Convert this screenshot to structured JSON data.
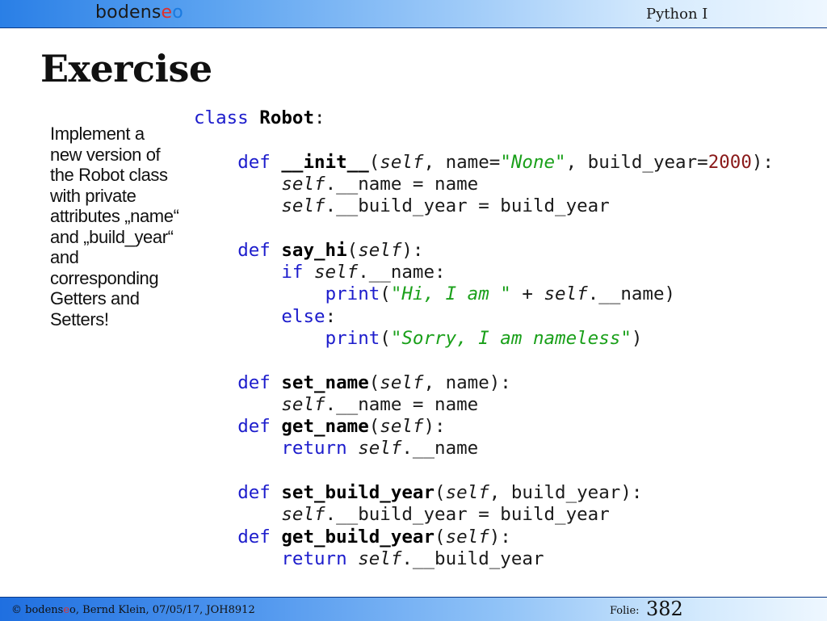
{
  "header": {
    "logo_main": "bodens",
    "logo_e": "e",
    "logo_o": "o",
    "course": "Python I"
  },
  "title": "Exercise",
  "side_text": "Implement a new version of the Robot class with private attributes „name“ and „build_year“ and corresponding Getters and Setters!",
  "code_lines": [
    "class Robot:",
    "",
    "    def __init__(self, name=\"None\", build_year=2000):",
    "        self.__name = name",
    "        self.__build_year = build_year",
    "",
    "    def say_hi(self):",
    "        if self.__name:",
    "            print(\"Hi, I am \" + self.__name)",
    "        else:",
    "            print(\"Sorry, I am nameless\")",
    "",
    "    def set_name(self, name):",
    "        self.__name = name",
    "    def get_name(self):",
    "        return self.__name",
    "",
    "    def set_build_year(self, build_year):",
    "        self.__build_year = build_year",
    "    def get_build_year(self):",
    "        return self.__build_year"
  ],
  "footer": {
    "copyright_prefix": "© bodens",
    "copyright_e": "e",
    "copyright_rest": "o, Bernd Klein, 07/05/17, JOH8912",
    "slide_label": "Folie:",
    "slide_number": "382"
  }
}
